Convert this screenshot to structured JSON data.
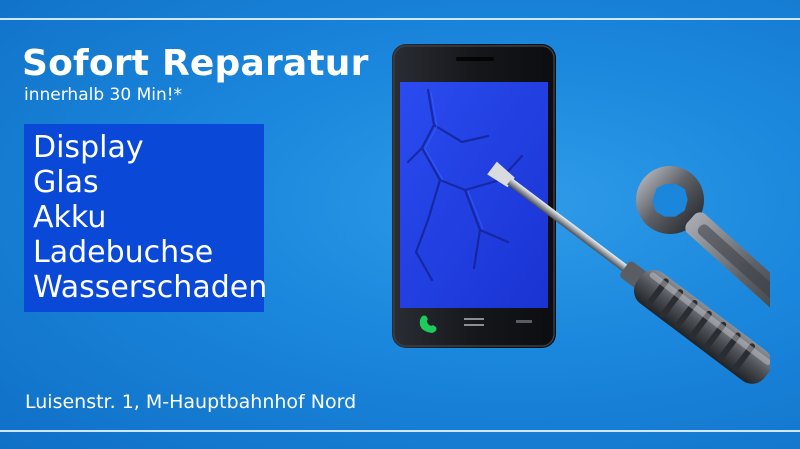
{
  "banner": {
    "headline": "Sofort Reparatur",
    "subline": "innerhalb 30 Min!*",
    "services": [
      "Display",
      "Glas",
      "Akku",
      "Ladebuchse",
      "Wasserschaden"
    ],
    "address": "Luisenstr. 1, M-Hauptbahnhof Nord"
  },
  "illustration": {
    "phone_icon": "smartphone-icon",
    "screwdriver_icon": "screwdriver-icon",
    "wrench_icon": "wrench-icon",
    "call_icon": "call-icon"
  },
  "colors": {
    "background": "#1a86dc",
    "service_box": "#0a48d8",
    "phone_screen": "#1f3fe0",
    "text": "#ffffff"
  }
}
